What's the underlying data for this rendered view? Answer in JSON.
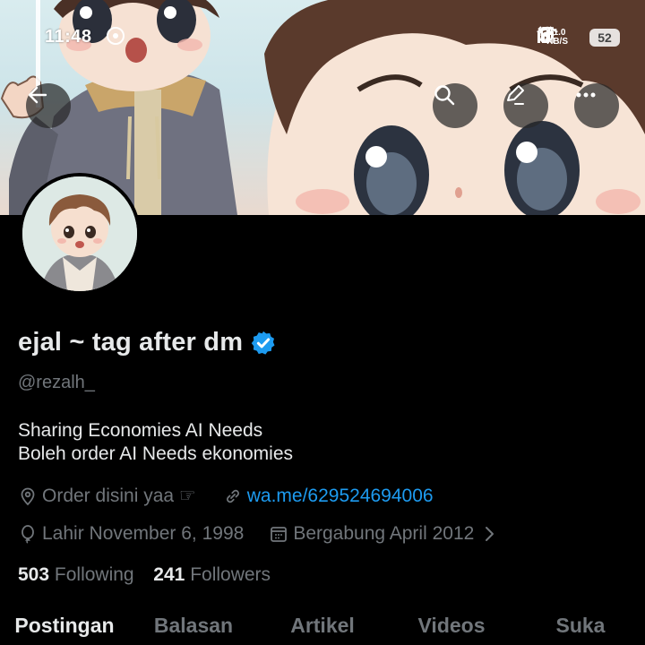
{
  "status_bar": {
    "time": "11:48",
    "net_speed_value": "11.0",
    "net_speed_unit": "KB/S",
    "battery": "52"
  },
  "header_buttons": {
    "back": "arrow-left-icon",
    "search": "search-icon",
    "edit": "edit-icon",
    "more": "more-icon"
  },
  "profile": {
    "display_name": "ejal ~ tag after dm",
    "handle": "@rezalh_",
    "bio_lines": [
      "Sharing Economies AI Needs",
      "Boleh order AI Needs ekonomies"
    ],
    "location": "Order disini yaa ☞",
    "website": "wa.me/629524694006",
    "birthday": "Lahir November 6, 1998",
    "joined": "Bergabung April 2012",
    "following_count": "503",
    "following_label": "Following",
    "followers_count": "241",
    "followers_label": "Followers"
  },
  "tabs": [
    {
      "label": "Postingan",
      "active": true
    },
    {
      "label": "Balasan",
      "active": false
    },
    {
      "label": "Artikel",
      "active": false
    },
    {
      "label": "Videos",
      "active": false
    },
    {
      "label": "Suka",
      "active": false
    }
  ],
  "colors": {
    "background": "#000000",
    "text_primary": "#e7e9ea",
    "text_secondary": "#71767b",
    "link": "#1d9bf0",
    "verified": "#1d9bf0"
  }
}
